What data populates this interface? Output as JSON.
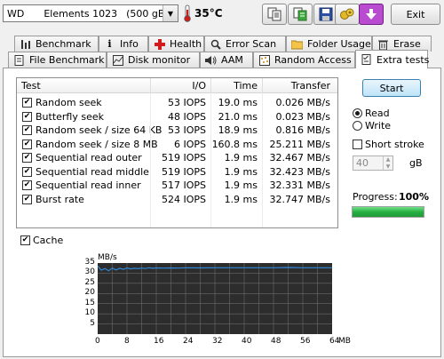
{
  "toolbar": {
    "drive_label": "WD",
    "drive_model": "Elements 1023",
    "drive_size": "(500 gB)",
    "temperature": "35°C",
    "exit_label": "Exit",
    "buttons": [
      "copy-text",
      "copy-info",
      "save",
      "options",
      "menu"
    ]
  },
  "tabs_row1": [
    {
      "label": "Benchmark",
      "icon": "benchmark-icon"
    },
    {
      "label": "Info",
      "icon": "info-icon"
    },
    {
      "label": "Health",
      "icon": "health-icon"
    },
    {
      "label": "Error Scan",
      "icon": "error-scan-icon"
    },
    {
      "label": "Folder Usage",
      "icon": "folder-icon"
    },
    {
      "label": "Erase",
      "icon": "erase-icon"
    }
  ],
  "tabs_row2": [
    {
      "label": "File Benchmark",
      "icon": "file-benchmark-icon"
    },
    {
      "label": "Disk monitor",
      "icon": "disk-monitor-icon"
    },
    {
      "label": "AAM",
      "icon": "speaker-icon"
    },
    {
      "label": "Random Access",
      "icon": "random-access-icon"
    },
    {
      "label": "Extra tests",
      "icon": "extra-tests-icon",
      "active": true
    }
  ],
  "table": {
    "headers": {
      "test": "Test",
      "io": "I/O",
      "time": "Time",
      "transfer": "Transfer"
    },
    "rows": [
      {
        "name": "Random seek",
        "io": "53 IOPS",
        "time": "19.0 ms",
        "transfer": "0.026 MB/s",
        "checked": true
      },
      {
        "name": "Butterfly seek",
        "io": "48 IOPS",
        "time": "21.0 ms",
        "transfer": "0.023 MB/s",
        "checked": true
      },
      {
        "name": "Random seek / size 64 KB",
        "io": "53 IOPS",
        "time": "18.9 ms",
        "transfer": "0.816 MB/s",
        "checked": true
      },
      {
        "name": "Random seek / size 8 MB",
        "io": "6 IOPS",
        "time": "160.8 ms",
        "transfer": "25.211 MB/s",
        "checked": true
      },
      {
        "name": "Sequential read outer",
        "io": "519 IOPS",
        "time": "1.9 ms",
        "transfer": "32.467 MB/s",
        "checked": true
      },
      {
        "name": "Sequential read middle",
        "io": "519 IOPS",
        "time": "1.9 ms",
        "transfer": "32.423 MB/s",
        "checked": true
      },
      {
        "name": "Sequential read inner",
        "io": "517 IOPS",
        "time": "1.9 ms",
        "transfer": "32.331 MB/s",
        "checked": true
      },
      {
        "name": "Burst rate",
        "io": "524 IOPS",
        "time": "1.9 ms",
        "transfer": "32.747 MB/s",
        "checked": true
      }
    ]
  },
  "controls": {
    "start_label": "Start",
    "read_label": "Read",
    "write_label": "Write",
    "mode_selected": "read",
    "short_stroke_label": "Short stroke",
    "short_stroke_checked": false,
    "short_stroke_value": "40",
    "short_stroke_unit": "gB",
    "progress_label": "Progress:",
    "progress_text": "100%",
    "progress_value": 1.0,
    "cache_label": "Cache",
    "cache_checked": true
  },
  "chart_data": {
    "type": "line",
    "ylabel": "MB/s",
    "xunit": "MB",
    "ylim": [
      0,
      35
    ],
    "xlim": [
      0,
      64
    ],
    "y_ticks": [
      35,
      30,
      25,
      20,
      15,
      10,
      5
    ],
    "x_ticks": [
      0,
      8,
      16,
      24,
      32,
      40,
      48,
      56,
      64
    ],
    "grid": true,
    "background": "#2d2d2d",
    "line_color": "#2f88d8",
    "grid_color": "#6a6a6a",
    "series": [
      {
        "x": [
          0,
          1,
          2,
          3,
          4,
          5,
          6,
          7,
          8,
          9,
          10,
          11,
          12,
          13,
          14,
          15,
          16,
          18,
          20,
          22,
          24,
          28,
          32,
          36,
          40,
          44,
          48,
          52,
          56,
          60,
          64
        ],
        "values": [
          33.5,
          31.5,
          32.3,
          31.2,
          32.5,
          31.6,
          32.4,
          31.9,
          32.6,
          32.1,
          32.4,
          32.2,
          32.5,
          32.3,
          32.7,
          32.4,
          32.6,
          32.5,
          32.6,
          32.5,
          32.7,
          32.6,
          32.7,
          32.7,
          32.7,
          32.7,
          32.7,
          32.8,
          32.7,
          32.7,
          32.7
        ]
      }
    ]
  }
}
